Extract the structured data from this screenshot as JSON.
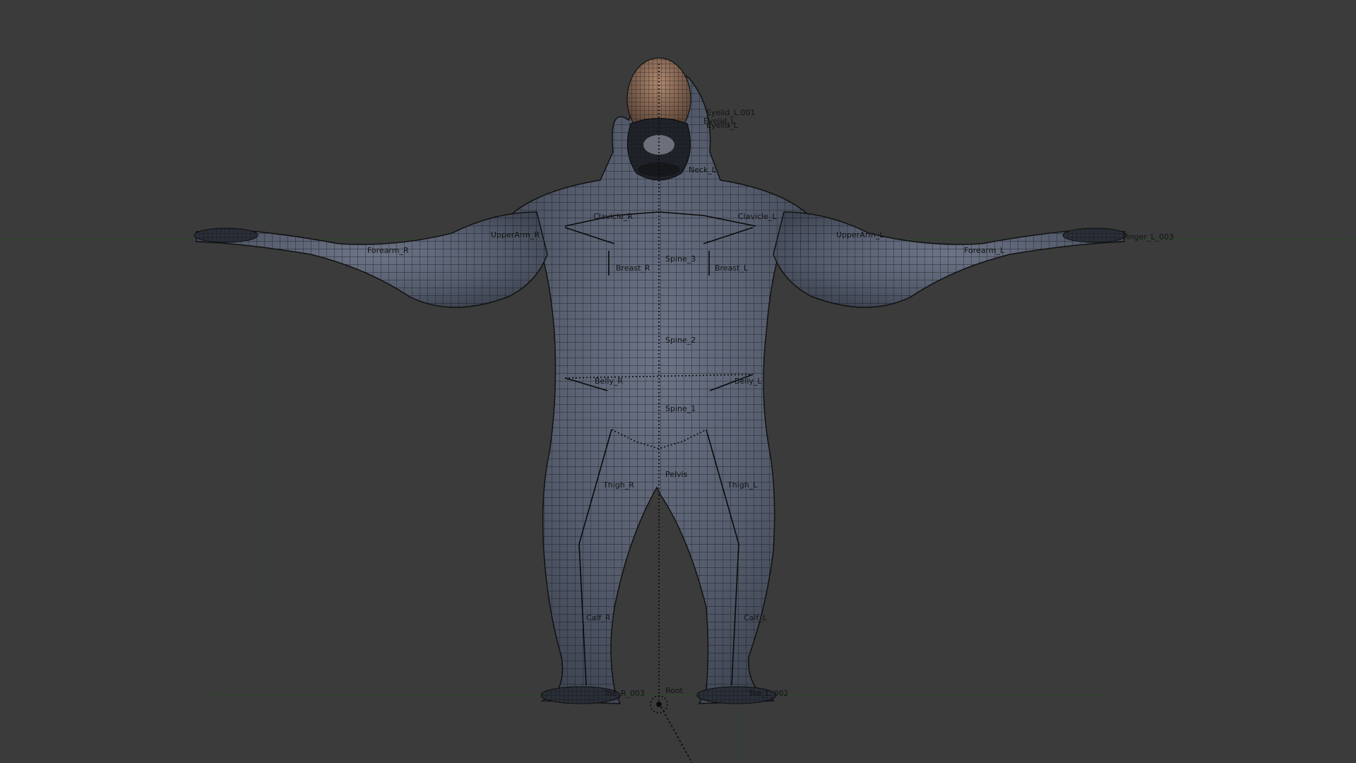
{
  "viewport": {
    "background": "#3b3b3b",
    "grid_color": "#2f4a2f",
    "mesh_wire_color": "#141820",
    "skin_color": "#5b6272",
    "face_color": "#a58068"
  },
  "bones": {
    "eyelid_l_001": "Eyelid_L.001",
    "eyelid_l_partial": "Eyelid_L",
    "eyelid_l": "Eyelid_L",
    "neck_partial": "Neck_L",
    "clavicle_r": "Clavicle_R",
    "clavicle_l": "Clavicle_L",
    "upperarm_r": "UpperArm_R",
    "upperarm_l": "UpperArm_L",
    "forearm_r": "Forearm_R",
    "forearm_l": "Forearm_L",
    "hand_l_cluster": "Finger_L_003",
    "spine_3": "Spine_3",
    "breast_r": "Breast_R",
    "breast_l": "Breast_L",
    "spine_2": "Spine_2",
    "belly_r": "Belly_R",
    "belly_l": "Belly_L",
    "spine_1": "Spine_1",
    "pelvis": "Pelvis",
    "thigh_r": "Thigh_R",
    "thigh_l": "Thigh_L",
    "calf_r": "Calf_R",
    "calf_l": "Calf_L",
    "toe_r": "Toe_R_003",
    "toe_l": "Toe_L_002",
    "root": "Root"
  }
}
